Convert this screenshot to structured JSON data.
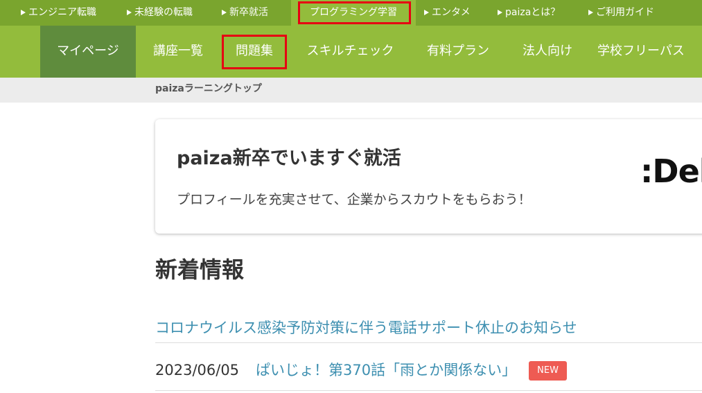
{
  "top_nav": {
    "items": [
      {
        "label": "エンジニア転職"
      },
      {
        "label": "未経験の転職"
      },
      {
        "label": "新卒就活"
      },
      {
        "label": "プログラミング学習"
      },
      {
        "label": "エンタメ"
      },
      {
        "label": "paizaとは？"
      },
      {
        "label": "ご利用ガイド"
      }
    ]
  },
  "main_nav": {
    "items": [
      {
        "label": "マイページ"
      },
      {
        "label": "講座一覧"
      },
      {
        "label": "問題集"
      },
      {
        "label": "スキルチェック"
      },
      {
        "label": "有料プラン"
      },
      {
        "label": "法人向け"
      },
      {
        "label": "学校フリーパス"
      }
    ]
  },
  "breadcrumb": {
    "label": "paizaラーニングトップ"
  },
  "promo": {
    "title": "paiza新卒でいますぐ就活",
    "subtitle": "プロフィールを充実させて、企業からスカウトをもらおう！",
    "logo_text": ":Del"
  },
  "news": {
    "heading": "新着情報",
    "items": [
      {
        "date": "",
        "title": "コロナウイルス感染予防対策に伴う電話サポート休止のお知らせ",
        "badge": ""
      },
      {
        "date": "2023/06/05",
        "title": "ぱいじょ！第370話「雨とか関係ない」",
        "badge": "NEW"
      }
    ]
  },
  "colors": {
    "top_nav_bg": "#7aa52e",
    "main_nav_bg": "#93bc3c",
    "current_nav_bg": "#5f8c3d",
    "highlight_border": "#e60012",
    "link": "#3d8fb0",
    "badge": "#ee5b53"
  }
}
